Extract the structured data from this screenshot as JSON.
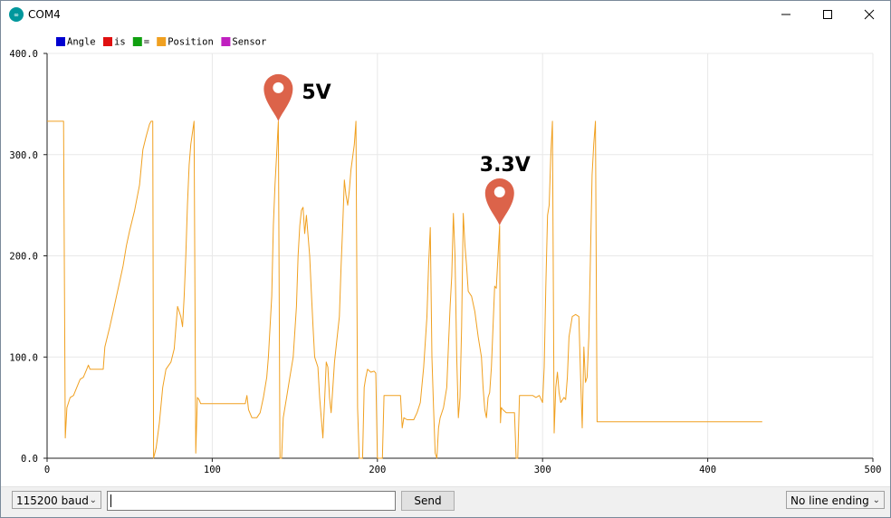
{
  "window": {
    "title": "COM4"
  },
  "legend": [
    {
      "label": "Angle",
      "color": "#0000d0"
    },
    {
      "label": "is",
      "color": "#e01010"
    },
    {
      "label": "=",
      "color": "#10a010"
    },
    {
      "label": "Position",
      "color": "#f0a020"
    },
    {
      "label": "Sensor",
      "color": "#c020c0"
    }
  ],
  "chart_data": {
    "type": "line",
    "xlim": [
      0,
      500
    ],
    "ylim": [
      0,
      400
    ],
    "x_ticks": [
      "0",
      "100",
      "200",
      "300",
      "400",
      "500"
    ],
    "y_ticks": [
      "0.0",
      "100.0",
      "200.0",
      "300.0",
      "400.0"
    ],
    "grid": true,
    "series": [
      {
        "name": "Position",
        "color": "#f0a020",
        "points": [
          [
            0,
            333
          ],
          [
            10,
            333
          ],
          [
            11,
            20
          ],
          [
            12,
            50
          ],
          [
            14,
            60
          ],
          [
            16,
            62
          ],
          [
            18,
            70
          ],
          [
            20,
            78
          ],
          [
            22,
            80
          ],
          [
            24,
            88
          ],
          [
            25,
            92
          ],
          [
            26,
            88
          ],
          [
            34,
            88
          ],
          [
            35,
            110
          ],
          [
            38,
            130
          ],
          [
            40,
            145
          ],
          [
            42,
            160
          ],
          [
            44,
            175
          ],
          [
            46,
            190
          ],
          [
            48,
            210
          ],
          [
            50,
            225
          ],
          [
            53,
            245
          ],
          [
            56,
            270
          ],
          [
            58,
            305
          ],
          [
            60,
            318
          ],
          [
            62,
            330
          ],
          [
            63,
            333
          ],
          [
            64,
            333
          ],
          [
            64.5,
            0
          ],
          [
            66,
            10
          ],
          [
            68,
            35
          ],
          [
            70,
            70
          ],
          [
            72,
            88
          ],
          [
            75,
            95
          ],
          [
            77,
            108
          ],
          [
            78,
            130
          ],
          [
            79,
            150
          ],
          [
            81,
            140
          ],
          [
            82,
            130
          ],
          [
            83,
            160
          ],
          [
            84,
            200
          ],
          [
            85,
            250
          ],
          [
            86,
            290
          ],
          [
            87,
            310
          ],
          [
            89,
            333
          ],
          [
            90,
            5
          ],
          [
            91,
            60
          ],
          [
            92,
            58
          ],
          [
            93,
            54
          ],
          [
            120,
            54
          ],
          [
            121,
            62
          ],
          [
            122,
            48
          ],
          [
            124,
            40
          ],
          [
            127,
            40
          ],
          [
            129,
            45
          ],
          [
            131,
            60
          ],
          [
            133,
            80
          ],
          [
            134,
            100
          ],
          [
            136,
            160
          ],
          [
            137,
            230
          ],
          [
            138,
            270
          ],
          [
            139,
            300
          ],
          [
            140,
            333
          ],
          [
            141,
            0
          ],
          [
            142,
            0
          ],
          [
            143,
            40
          ],
          [
            145,
            60
          ],
          [
            147,
            80
          ],
          [
            149,
            100
          ],
          [
            151,
            150
          ],
          [
            152,
            200
          ],
          [
            153,
            230
          ],
          [
            154,
            245
          ],
          [
            155,
            248
          ],
          [
            156,
            222
          ],
          [
            157,
            240
          ],
          [
            158,
            220
          ],
          [
            159,
            200
          ],
          [
            160,
            165
          ],
          [
            161,
            130
          ],
          [
            162,
            100
          ],
          [
            164,
            90
          ],
          [
            165,
            60
          ],
          [
            166,
            40
          ],
          [
            167,
            20
          ],
          [
            168,
            55
          ],
          [
            169,
            95
          ],
          [
            170,
            90
          ],
          [
            171,
            60
          ],
          [
            172,
            45
          ],
          [
            173,
            70
          ],
          [
            174,
            95
          ],
          [
            176,
            125
          ],
          [
            177,
            140
          ],
          [
            178,
            190
          ],
          [
            179,
            230
          ],
          [
            180,
            275
          ],
          [
            181,
            260
          ],
          [
            182,
            250
          ],
          [
            183,
            265
          ],
          [
            184,
            285
          ],
          [
            186,
            310
          ],
          [
            187,
            333
          ],
          [
            188,
            50
          ],
          [
            189,
            0
          ],
          [
            191,
            0
          ],
          [
            192,
            70
          ],
          [
            193,
            80
          ],
          [
            194,
            88
          ],
          [
            196,
            85
          ],
          [
            198,
            86
          ],
          [
            199,
            84
          ],
          [
            200,
            0
          ],
          [
            203,
            0
          ],
          [
            204,
            62
          ],
          [
            214,
            62
          ],
          [
            215,
            30
          ],
          [
            216,
            40
          ],
          [
            218,
            38
          ],
          [
            222,
            38
          ],
          [
            224,
            45
          ],
          [
            226,
            55
          ],
          [
            228,
            90
          ],
          [
            230,
            140
          ],
          [
            231,
            190
          ],
          [
            232,
            228
          ],
          [
            233,
            100
          ],
          [
            234,
            50
          ],
          [
            235,
            5
          ],
          [
            236,
            0
          ],
          [
            237,
            30
          ],
          [
            238,
            40
          ],
          [
            240,
            50
          ],
          [
            242,
            70
          ],
          [
            243,
            110
          ],
          [
            244,
            150
          ],
          [
            245,
            180
          ],
          [
            246,
            242
          ],
          [
            247,
            200
          ],
          [
            248,
            100
          ],
          [
            249,
            40
          ],
          [
            250,
            60
          ],
          [
            251,
            130
          ],
          [
            252,
            242
          ],
          [
            253,
            210
          ],
          [
            254,
            190
          ],
          [
            255,
            165
          ],
          [
            257,
            160
          ],
          [
            259,
            145
          ],
          [
            261,
            120
          ],
          [
            263,
            100
          ],
          [
            264,
            70
          ],
          [
            265,
            48
          ],
          [
            266,
            40
          ],
          [
            267,
            60
          ],
          [
            268,
            65
          ],
          [
            269,
            90
          ],
          [
            270,
            130
          ],
          [
            271,
            170
          ],
          [
            272,
            168
          ],
          [
            273,
            200
          ],
          [
            274,
            230
          ],
          [
            274.5,
            35
          ],
          [
            275,
            50
          ],
          [
            276,
            48
          ],
          [
            278,
            45
          ],
          [
            283,
            45
          ],
          [
            284,
            0
          ],
          [
            285,
            0
          ],
          [
            286,
            62
          ],
          [
            294,
            62
          ],
          [
            296,
            60
          ],
          [
            298,
            62
          ],
          [
            300,
            55
          ],
          [
            301,
            90
          ],
          [
            302,
            170
          ],
          [
            303,
            240
          ],
          [
            304,
            250
          ],
          [
            305,
            300
          ],
          [
            306,
            333
          ],
          [
            307,
            25
          ],
          [
            308,
            70
          ],
          [
            309,
            85
          ],
          [
            310,
            65
          ],
          [
            311,
            55
          ],
          [
            313,
            60
          ],
          [
            314,
            58
          ],
          [
            315,
            80
          ],
          [
            316,
            120
          ],
          [
            318,
            140
          ],
          [
            320,
            142
          ],
          [
            322,
            140
          ],
          [
            323,
            80
          ],
          [
            324,
            30
          ],
          [
            325,
            110
          ],
          [
            326,
            75
          ],
          [
            327,
            80
          ],
          [
            328,
            120
          ],
          [
            329,
            200
          ],
          [
            330,
            280
          ],
          [
            331,
            310
          ],
          [
            332,
            333
          ],
          [
            333,
            36
          ],
          [
            433,
            36
          ]
        ]
      }
    ]
  },
  "annotations": [
    {
      "label": "5V",
      "x": 140,
      "y": 333
    },
    {
      "label": "3.3V",
      "x": 274,
      "y": 230
    }
  ],
  "bottom": {
    "baud": "115200 baud",
    "input_value": "",
    "send_label": "Send",
    "line_ending": "No line ending"
  }
}
